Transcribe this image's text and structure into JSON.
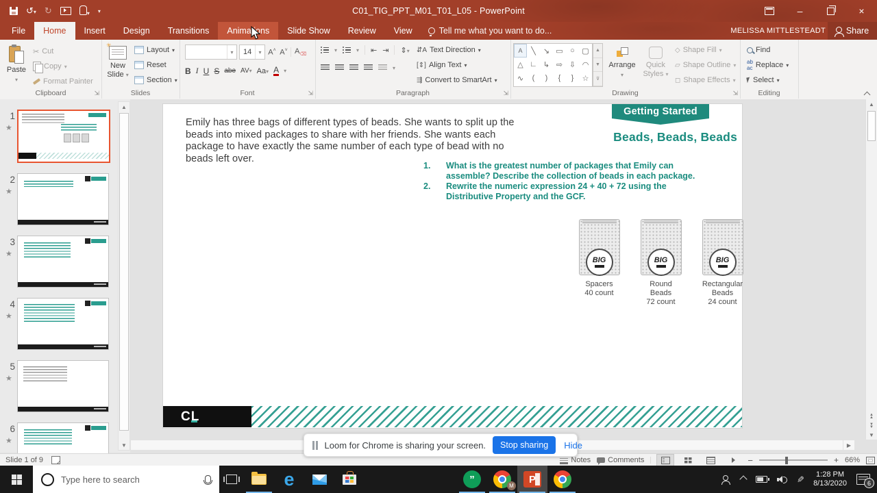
{
  "window": {
    "title": "C01_TIG_PPT_M01_T01_L05 - PowerPoint",
    "account": "MELISSA MITTLESTEADT",
    "share": "Share"
  },
  "tabs": {
    "file": "File",
    "home": "Home",
    "insert": "Insert",
    "design": "Design",
    "transitions": "Transitions",
    "animations": "Animations",
    "slideshow": "Slide Show",
    "review": "Review",
    "view": "View",
    "tellme": "Tell me what you want to do..."
  },
  "ribbon": {
    "clipboard": {
      "label": "Clipboard",
      "paste": "Paste",
      "cut": "Cut",
      "copy": "Copy",
      "format_painter": "Format Painter"
    },
    "slides": {
      "label": "Slides",
      "new_slide_1": "New",
      "new_slide_2": "Slide",
      "layout": "Layout",
      "reset": "Reset",
      "section": "Section"
    },
    "font": {
      "label": "Font",
      "size": "14",
      "bold": "B",
      "italic": "I",
      "underline": "U",
      "strike": "S",
      "abe": "abe",
      "av": "AV",
      "aa": "Aa",
      "color_a": "A"
    },
    "paragraph": {
      "label": "Paragraph",
      "text_direction": "Text Direction",
      "align_text": "Align Text",
      "smartart": "Convert to SmartArt"
    },
    "drawing": {
      "label": "Drawing",
      "arrange": "Arrange",
      "quick1": "Quick",
      "quick2": "Styles",
      "fill": "Shape Fill",
      "outline": "Shape Outline",
      "effects": "Shape Effects",
      "shapes": [
        [
          "A",
          "╲",
          "↘",
          "▭",
          "○",
          "▢"
        ],
        [
          "△",
          "∟",
          "↳",
          "⇨",
          "⇩",
          "◠"
        ],
        [
          "∿",
          "(",
          ")",
          "{",
          "}",
          "☆"
        ]
      ]
    },
    "editing": {
      "label": "Editing",
      "find": "Find",
      "replace": "Replace",
      "select": "Select"
    }
  },
  "panel": {
    "slides": [
      {
        "n": "1"
      },
      {
        "n": "2"
      },
      {
        "n": "3"
      },
      {
        "n": "4"
      },
      {
        "n": "5"
      },
      {
        "n": "6"
      }
    ]
  },
  "slide": {
    "intro": "Emily has three bags of different types of beads. She wants to split up the beads into mixed packages to share with her friends. She wants each package to have exactly the same number of each type of bead with no beads left over.",
    "banner": "Getting Started",
    "title": "Beads, Beads, Beads",
    "q1n": "1.",
    "q1": "What is the greatest number of packages that Emily can assemble? Describe the collection of beads in each package.",
    "q2n": "2.",
    "q2": "Rewrite the numeric expression 24 + 40 + 72 using the Distributive Property and the GCF.",
    "bags": [
      {
        "logo": "BIG",
        "l1": "Spacers",
        "l2": "40 count",
        "l3": ""
      },
      {
        "logo": "BIG",
        "l1": "Round",
        "l2": "Beads",
        "l3": "72 count"
      },
      {
        "logo": "BIG",
        "l1": "Rectangular",
        "l2": "Beads",
        "l3": "24 count"
      }
    ],
    "cl_c": "C",
    "cl_l": "L"
  },
  "loom": {
    "message": "Loom for Chrome is sharing your screen.",
    "stop": "Stop sharing",
    "hide": "Hide"
  },
  "status": {
    "slide": "Slide 1 of 9",
    "notes": "Notes",
    "comments": "Comments",
    "zoom_level": "66%"
  },
  "taskbar": {
    "search": "Type here to search",
    "time": "1:28 PM",
    "date": "8/13/2020",
    "badge": "6",
    "edge": "e",
    "hangouts": "”",
    "ppt": "P",
    "chrome_badge": "M"
  },
  "colors": {
    "teal": "#1a8c7f",
    "title_red": "#a23f29",
    "loom_blue": "#1a73e8",
    "select_orange": "#e8542f"
  }
}
